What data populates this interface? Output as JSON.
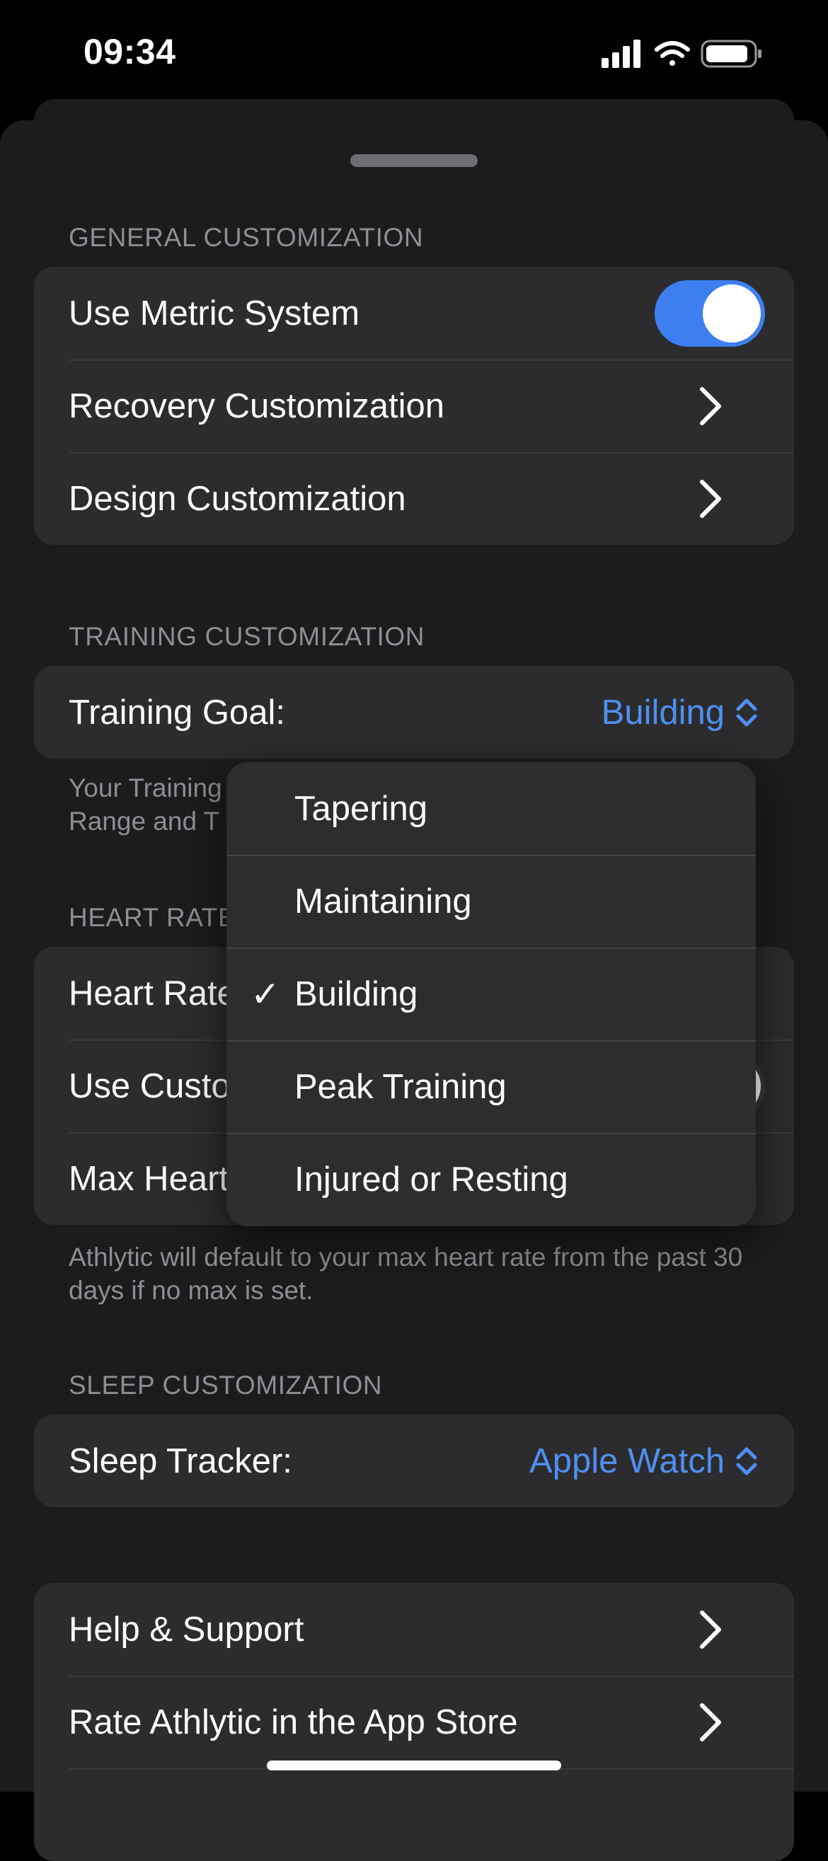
{
  "status_bar": {
    "time": "09:34"
  },
  "general": {
    "header": "GENERAL CUSTOMIZATION",
    "rows": [
      {
        "label": "Use Metric System",
        "toggle_on": true
      },
      {
        "label": "Recovery Customization"
      },
      {
        "label": "Design Customization"
      }
    ]
  },
  "training": {
    "header": "TRAINING CUSTOMIZATION",
    "goal_label": "Training Goal:",
    "goal_value": "Building",
    "note_line1": "Your Training",
    "note_line2": "Range and T"
  },
  "heart_rate": {
    "header": "HEART RATE",
    "rows": [
      {
        "label": "Heart Rate"
      },
      {
        "label": "Use Custo"
      },
      {
        "label": "Max Heart"
      }
    ],
    "note": "Athlytic will default to your max heart rate from the past 30 days if no max is set."
  },
  "sleep": {
    "header": "SLEEP CUSTOMIZATION",
    "tracker_label": "Sleep Tracker:",
    "tracker_value": "Apple Watch"
  },
  "links": {
    "rows": [
      {
        "label": "Help & Support"
      },
      {
        "label": "Rate Athlytic in the App Store"
      }
    ]
  },
  "goal_menu": {
    "options": [
      "Tapering",
      "Maintaining",
      "Building",
      "Peak Training",
      "Injured or Resting"
    ],
    "selected": "Building"
  },
  "colors": {
    "accent": "#3d7ff0",
    "link": "#4f8ff2",
    "background": "#1c1c1e",
    "cell": "#2c2c2e"
  }
}
